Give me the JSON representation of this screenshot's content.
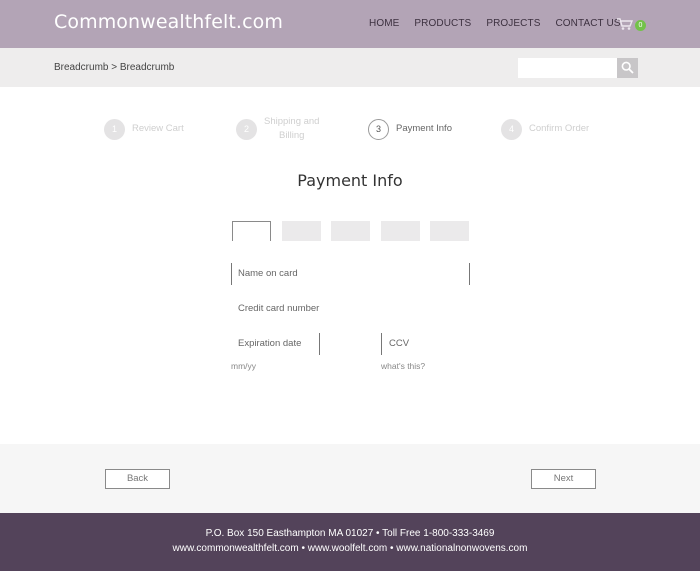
{
  "header": {
    "logo": "Commonwealthfelt.com",
    "nav": [
      "HOME",
      "PRODUCTS",
      "PROJECTS",
      "CONTACT US"
    ],
    "cart_count": "0",
    "cart_icon": "cart-icon",
    "colors": {
      "header_bg": "#b3a4b6",
      "badge": "#73c24a"
    }
  },
  "breadcrumb": {
    "text": "Breadcrumb > Breadcrumb"
  },
  "search": {
    "placeholder": "",
    "icon": "search-icon"
  },
  "steps": [
    {
      "number": "1",
      "label": "Review Cart"
    },
    {
      "number": "2",
      "label_line1": "Shipping and",
      "label_line2": "Billing"
    },
    {
      "number": "3",
      "label": "Payment Info",
      "active": true
    },
    {
      "number": "4",
      "label": "Confirm Order"
    }
  ],
  "page_title": "Payment Info",
  "form": {
    "name_on_card": "Name on card",
    "credit_card_number": "Credit card number",
    "expiration_date": "Expiration date",
    "expiration_hint": "mm/yy",
    "ccv": "CCV",
    "ccv_hint": "what's this?"
  },
  "buttons": {
    "back": "Back",
    "next": "Next"
  },
  "footer": {
    "line1": "P.O. Box 150 Easthampton MA 01027 • Toll Free 1-800-333-3469",
    "line2": "www.commonwealthfelt.com • www.woolfelt.com • www.nationalnonwovens.com",
    "colors": {
      "bg": "#53435a"
    }
  }
}
